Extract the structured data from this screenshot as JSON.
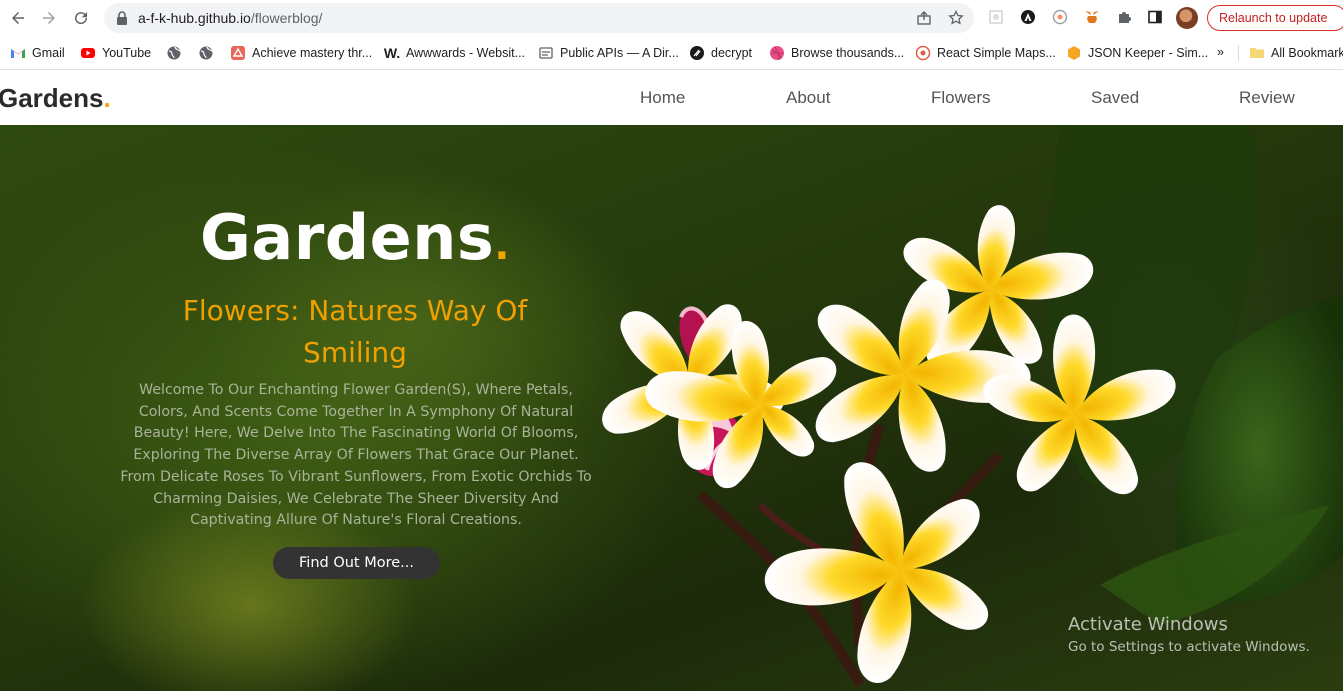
{
  "browser": {
    "url_host": "a-f-k-hub.github.io",
    "url_path": "/flowerblog/",
    "relaunch_label": "Relaunch to update",
    "bookmarks": [
      {
        "label": "Gmail",
        "icon": "gmail-icon"
      },
      {
        "label": "YouTube",
        "icon": "youtube-icon"
      },
      {
        "label": "",
        "icon": "globe-icon"
      },
      {
        "label": "",
        "icon": "globe-icon"
      },
      {
        "label": "Achieve mastery thr...",
        "icon": "bookmark-favicon"
      },
      {
        "label": "Awwwards - Websit...",
        "icon": "awwwards-icon"
      },
      {
        "label": "Public APIs — A Dir...",
        "icon": "api-icon"
      },
      {
        "label": "decrypt",
        "icon": "decrypt-icon"
      },
      {
        "label": "Browse thousands...",
        "icon": "dribbble-icon"
      },
      {
        "label": "React Simple Maps...",
        "icon": "maps-icon"
      },
      {
        "label": "JSON Keeper - Sim...",
        "icon": "json-icon"
      }
    ],
    "more_bookmarks": "»",
    "all_bookmarks": "All Bookmarks"
  },
  "site": {
    "logo_text": "Gardens",
    "logo_dot": ".",
    "nav": [
      "Home",
      "About",
      "Flowers",
      "Saved",
      "Review"
    ]
  },
  "hero": {
    "title": "Gardens",
    "title_dot": ".",
    "subtitle": "Flowers: Natures Way Of Smiling",
    "description": "Welcome To Our Enchanting Flower Garden(S), Where Petals, Colors, And Scents Come Together In A Symphony Of Natural Beauty! Here, We Delve Into The Fascinating World Of Blooms, Exploring The Diverse Array Of Flowers That Grace Our Planet. From Delicate Roses To Vibrant Sunflowers, From Exotic Orchids To Charming Daisies, We Celebrate The Sheer Diversity And Captivating Allure Of Nature's Floral Creations.",
    "cta_label": "Find Out More..."
  },
  "watermark": {
    "line1": "Activate Windows",
    "line2": "Go to Settings to activate Windows."
  },
  "colors": {
    "accent": "#f0a500",
    "relaunch": "#c5221f",
    "button_bg": "#333333"
  }
}
